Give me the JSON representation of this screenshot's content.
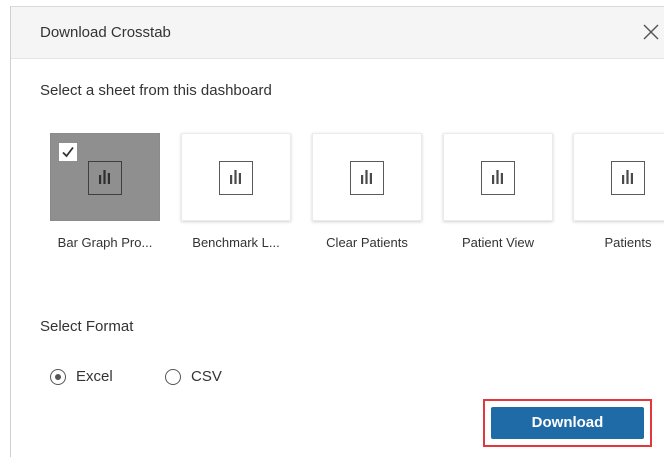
{
  "dialog": {
    "title": "Download Crosstab",
    "close_icon": "close-icon"
  },
  "sheet_section": {
    "label": "Select a sheet from this dashboard",
    "sheets": [
      {
        "label": "Bar Graph Pro...",
        "selected": true,
        "icon": "bar-chart-icon"
      },
      {
        "label": "Benchmark L...",
        "selected": false,
        "icon": "bar-chart-icon"
      },
      {
        "label": "Clear Patients",
        "selected": false,
        "icon": "bar-chart-icon"
      },
      {
        "label": "Patient View",
        "selected": false,
        "icon": "bar-chart-icon"
      },
      {
        "label": "Patients",
        "selected": false,
        "icon": "bar-chart-icon"
      }
    ]
  },
  "format_section": {
    "label": "Select Format",
    "options": [
      {
        "label": "Excel",
        "selected": true
      },
      {
        "label": "CSV",
        "selected": false
      }
    ]
  },
  "actions": {
    "download_label": "Download"
  },
  "colors": {
    "primary_button": "#1f6ba8",
    "highlight_border": "#e0383e",
    "selected_thumb": "#8f8f8f"
  }
}
